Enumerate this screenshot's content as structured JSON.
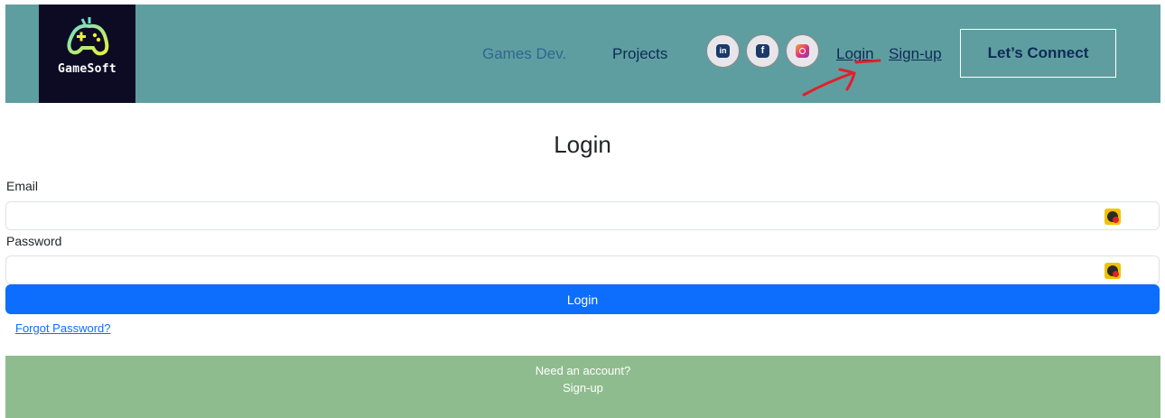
{
  "header": {
    "brand": "GameSoft",
    "nav": {
      "games_dev": "Games Dev.",
      "projects": "Projects"
    },
    "social": [
      {
        "name": "linkedin-icon",
        "glyph": "in"
      },
      {
        "name": "facebook-icon",
        "glyph": "f"
      },
      {
        "name": "instagram-icon",
        "glyph": ""
      }
    ],
    "auth": {
      "login": "Login",
      "signup": "Sign-up"
    },
    "connect_label": "Let’s Connect"
  },
  "form": {
    "title": "Login",
    "email_label": "Email",
    "email_value": "",
    "password_label": "Password",
    "password_value": "",
    "submit_label": "Login",
    "forgot_label": "Forgot Password?"
  },
  "footer": {
    "prompt": "Need an account?",
    "signup_label": "Sign-up"
  },
  "colors": {
    "navbar_bg": "#5f9ea0",
    "logo_bg": "#0d0b24",
    "primary_button": "#0d6efd",
    "footer_bg": "#8fbc8f",
    "annotation": "#e0202a"
  }
}
